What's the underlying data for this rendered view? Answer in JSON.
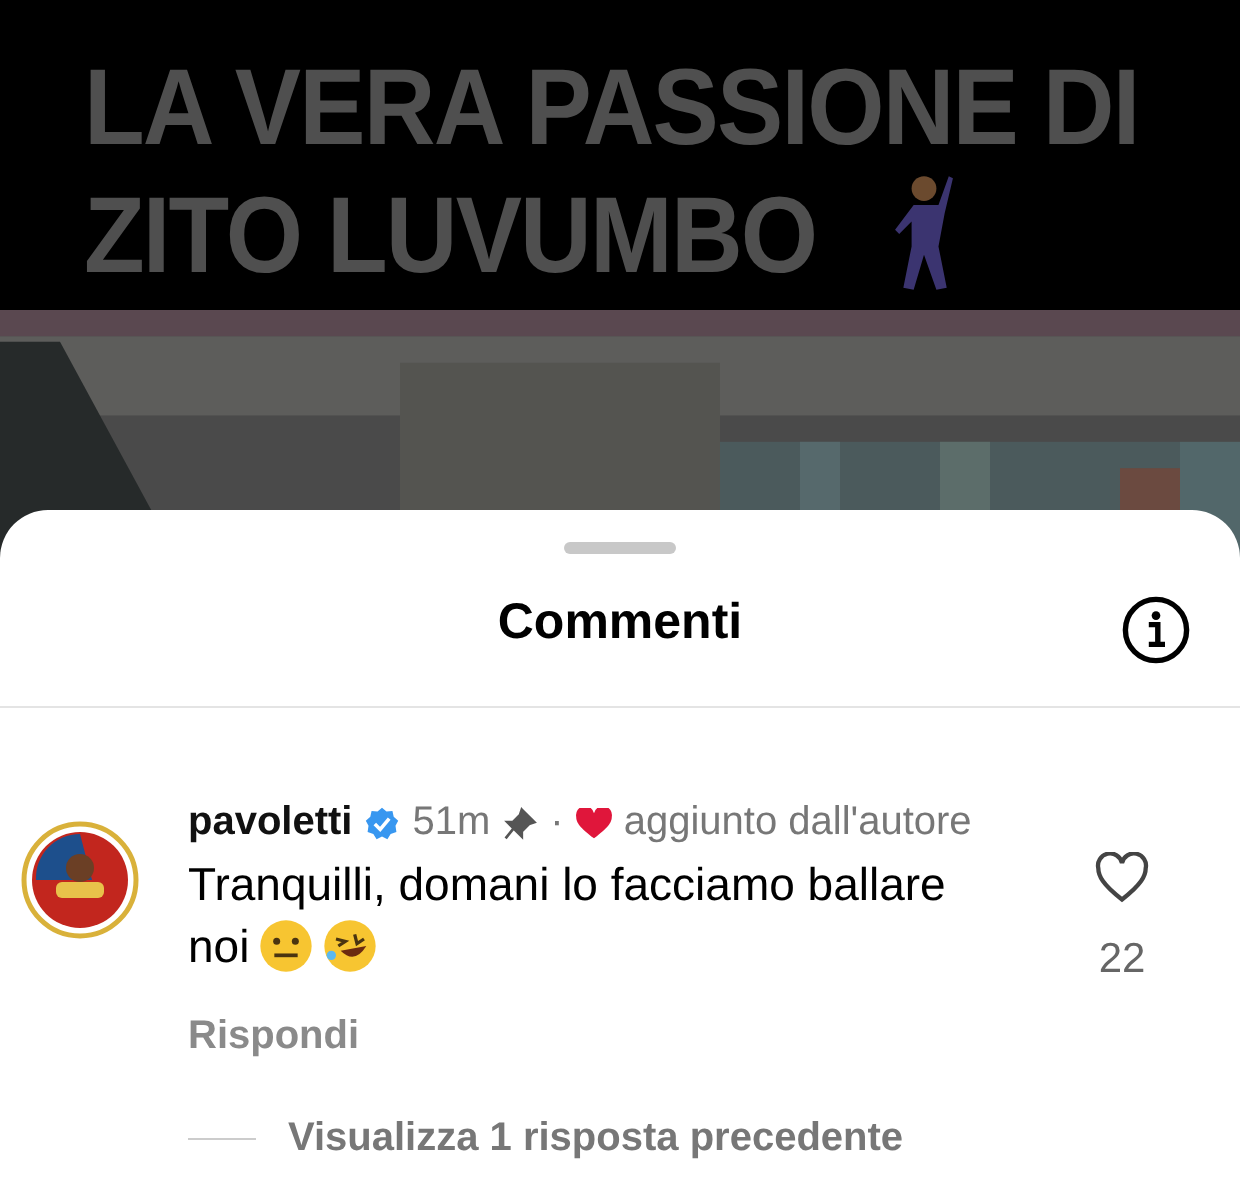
{
  "video": {
    "kind": "picture",
    "caption": [
      "LA VERA PASSIONE DI",
      "ZITO LUVUMBO"
    ]
  },
  "sheet": {
    "title": "Commenti"
  },
  "comments": [
    {
      "username": "pavoletti",
      "verified": true,
      "time": "51m",
      "pinned": true,
      "liked_by_author": true,
      "separator": "·",
      "author_note": "aggiunto dall'autore",
      "text_lines": [
        "Tranquilli, domani lo facciamo ballare",
        "noi"
      ],
      "liked": false,
      "likes": "22",
      "reply_label": "Rispondi",
      "replies_link": "Visualizza 1 risposta precedente"
    }
  ]
}
